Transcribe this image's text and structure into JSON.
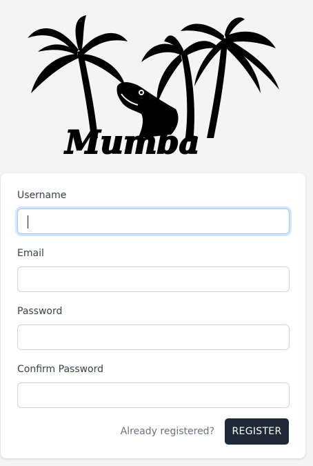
{
  "logo": {
    "text": "Mumba",
    "alt": "Mumba logo with palm trees and snake"
  },
  "form": {
    "fields": [
      {
        "label": "Username",
        "value": "",
        "focused": true
      },
      {
        "label": "Email",
        "value": "",
        "focused": false
      },
      {
        "label": "Password",
        "value": "",
        "focused": false
      },
      {
        "label": "Confirm Password",
        "value": "",
        "focused": false
      }
    ],
    "login_link": "Already registered?",
    "submit_label": "REGISTER"
  },
  "colors": {
    "background": "#f3f4f6",
    "button": "#1f2937",
    "focus_ring": "#a5c8ee"
  }
}
